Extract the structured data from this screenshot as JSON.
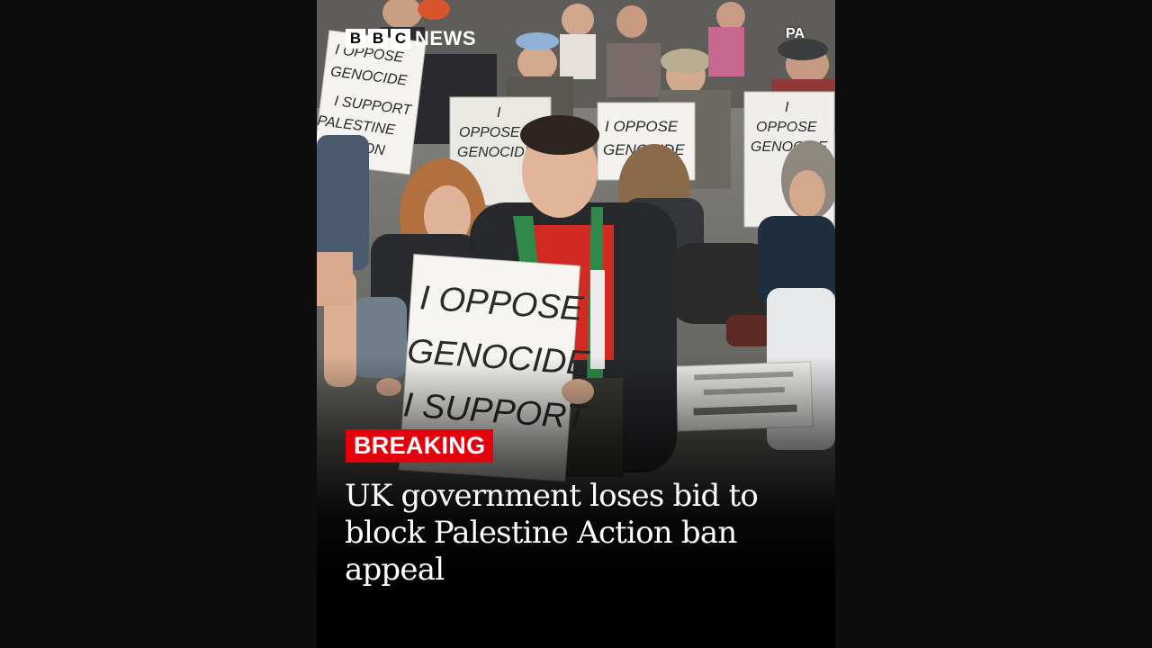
{
  "brand": {
    "letters": [
      "B",
      "B",
      "C"
    ],
    "name": "NEWS"
  },
  "credit": "PA",
  "badge": "BREAKING",
  "headline": "UK government loses bid to block Palestine Action ban appeal",
  "signs": {
    "main": [
      "I OPPOSE",
      "GENOCIDE",
      "I SUPPORT"
    ],
    "left": [
      "I OPPOSE",
      "GENOCIDE",
      "I SUPPORT",
      "PALESTINE",
      "ACTION"
    ],
    "center": [
      "I",
      "OPPOSE",
      "GENOCIDE"
    ],
    "right_mid": [
      "I OPPOSE",
      "GENOCIDE"
    ],
    "far_right": [
      "I",
      "OPPOSE",
      "GENOCIDE"
    ]
  },
  "colors": {
    "background": "#0d0d0d",
    "badge": "#e4010b",
    "text": "#ffffff"
  }
}
